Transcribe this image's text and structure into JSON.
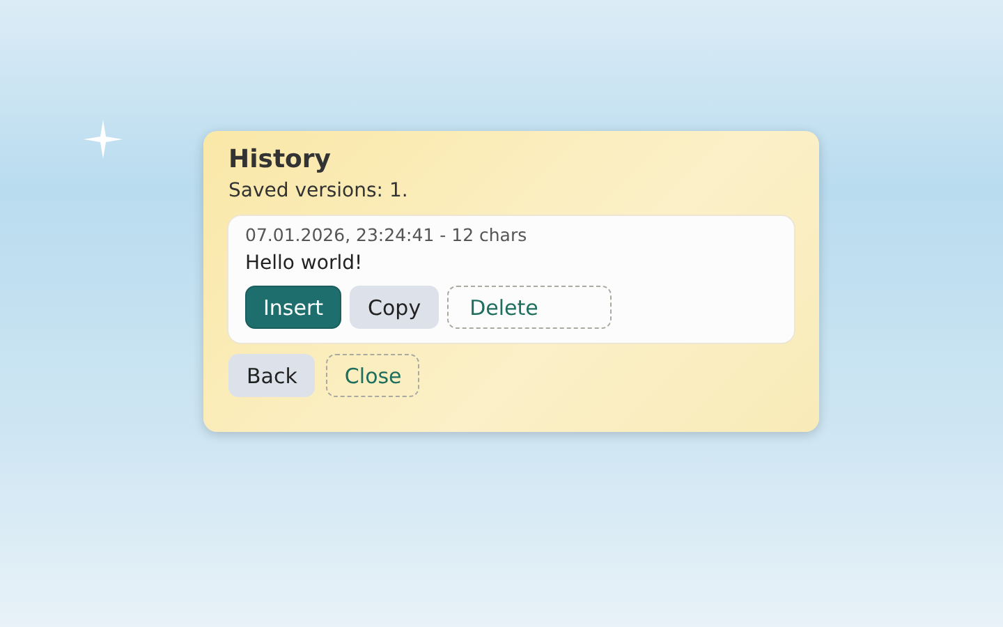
{
  "dialog": {
    "title": "History",
    "summary": "Saved versions: 1.",
    "versions": [
      {
        "meta": "07.01.2026, 23:24:41 - 12 chars",
        "text": "Hello world!",
        "actions": [
          {
            "label": "Insert",
            "kind": "primary"
          },
          {
            "label": "Copy",
            "kind": "secondary"
          },
          {
            "label": "Delete",
            "kind": "dashed"
          }
        ]
      }
    ],
    "buttons": [
      {
        "label": "Back",
        "kind": "secondary"
      },
      {
        "label": "Close",
        "kind": "dashed"
      }
    ]
  }
}
